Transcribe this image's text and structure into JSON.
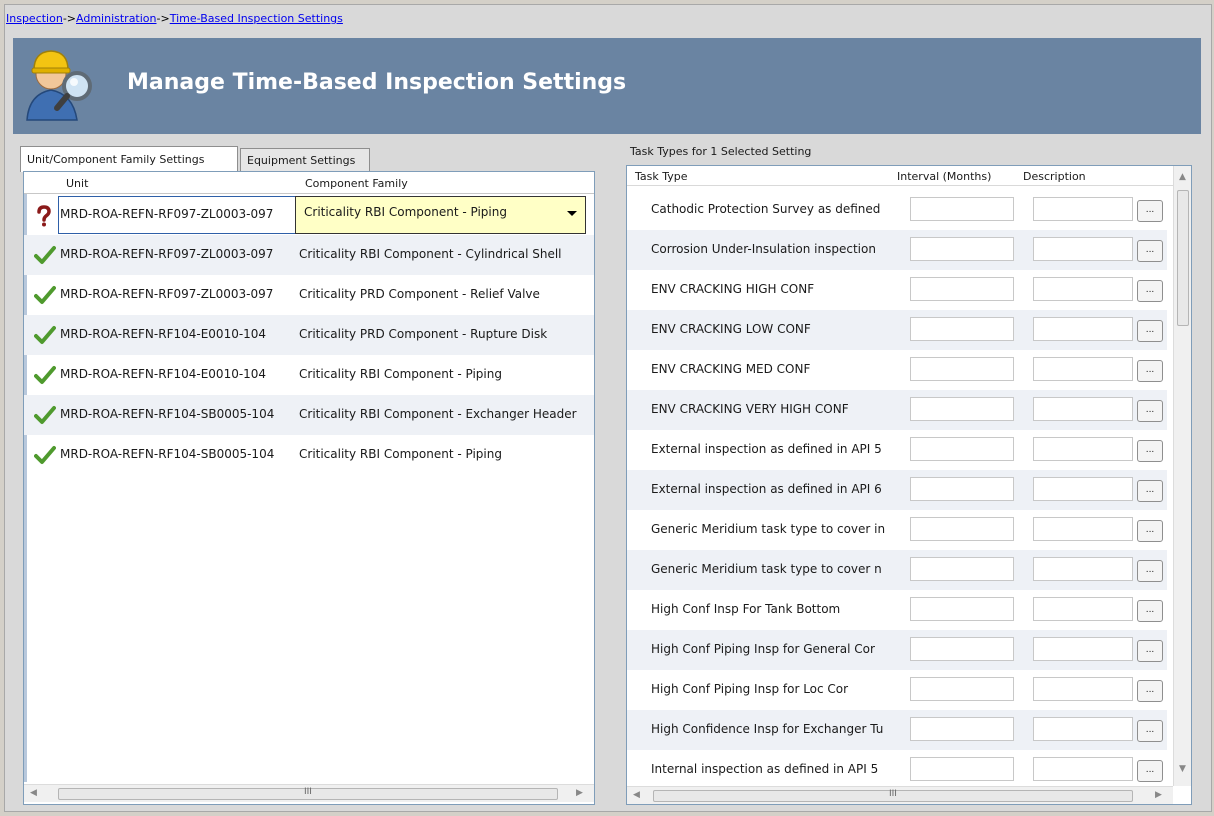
{
  "breadcrumb": {
    "items": [
      "Inspection",
      "Administration",
      "Time-Based Inspection Settings"
    ],
    "separator": "->"
  },
  "header": {
    "title": "Manage Time-Based Inspection Settings",
    "icon": "inspector-magnifier-icon",
    "bg_color": "#6a84a2"
  },
  "tabs": [
    {
      "label": "Unit/Component Family Settings",
      "active": true
    },
    {
      "label": "Equipment Settings",
      "active": false
    }
  ],
  "left_grid": {
    "columns": [
      "Unit",
      "Component Family"
    ],
    "rows": [
      {
        "status": "question",
        "unit": "MRD-ROA-REFN-RF097-ZL0003-097",
        "family": "Criticality RBI Component - Piping",
        "selected": true
      },
      {
        "status": "check",
        "unit": "MRD-ROA-REFN-RF097-ZL0003-097",
        "family": "Criticality RBI Component - Cylindrical Shell"
      },
      {
        "status": "check",
        "unit": "MRD-ROA-REFN-RF097-ZL0003-097",
        "family": "Criticality PRD Component - Relief Valve"
      },
      {
        "status": "check",
        "unit": "MRD-ROA-REFN-RF104-E0010-104",
        "family": "Criticality PRD Component - Rupture Disk"
      },
      {
        "status": "check",
        "unit": "MRD-ROA-REFN-RF104-E0010-104",
        "family": "Criticality RBI Component - Piping"
      },
      {
        "status": "check",
        "unit": "MRD-ROA-REFN-RF104-SB0005-104",
        "family": "Criticality RBI Component - Exchanger Header"
      },
      {
        "status": "check",
        "unit": "MRD-ROA-REFN-RF104-SB0005-104",
        "family": "Criticality RBI Component - Piping"
      }
    ]
  },
  "right_panel": {
    "title": "Task Types for 1 Selected Setting",
    "columns": [
      "Task Type",
      "Interval (Months)",
      "Description"
    ],
    "ellipsis_label": "...",
    "rows": [
      "Cathodic Protection Survey as defined",
      "Corrosion Under-Insulation inspection",
      "ENV CRACKING  HIGH CONF",
      "ENV CRACKING  LOW CONF",
      "ENV CRACKING  MED CONF",
      "ENV CRACKING VERY HIGH CONF",
      "External inspection as defined in API 5",
      "External inspection as defined in API 6",
      "Generic Meridium task type to cover in",
      "Generic Meridium task type to cover n",
      "High Conf Insp For Tank Bottom",
      "High Conf Piping Insp for General Cor",
      "High Conf Piping Insp for Loc Cor",
      "High Confidence Insp for Exchanger Tu",
      "Internal inspection as defined in API 5"
    ]
  },
  "scrollbar_grip": "III"
}
